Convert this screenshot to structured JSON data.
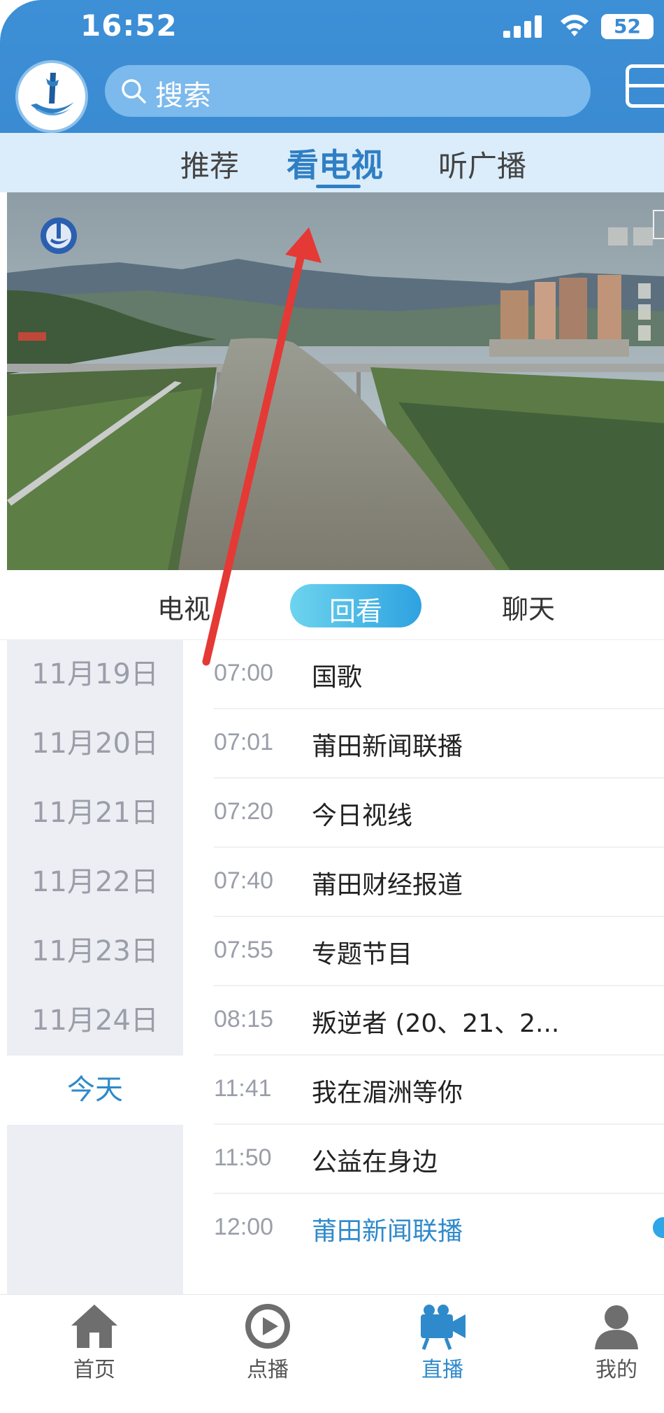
{
  "status_bar": {
    "time": "16:52",
    "battery": "52"
  },
  "header": {
    "search_placeholder": "搜索"
  },
  "channel_tabs": [
    {
      "label": "推荐",
      "active": false
    },
    {
      "label": "看电视",
      "active": true
    },
    {
      "label": "听广播",
      "active": false
    }
  ],
  "player_tabs": [
    {
      "label": "电视",
      "active": false
    },
    {
      "label": "回看",
      "active": true
    },
    {
      "label": "聊天",
      "active": false
    }
  ],
  "dates": [
    {
      "label": "11月19日",
      "active": false
    },
    {
      "label": "11月20日",
      "active": false
    },
    {
      "label": "11月21日",
      "active": false
    },
    {
      "label": "11月22日",
      "active": false
    },
    {
      "label": "11月23日",
      "active": false
    },
    {
      "label": "11月24日",
      "active": false
    },
    {
      "label": "今天",
      "active": true
    }
  ],
  "programs": [
    {
      "time": "07:00",
      "title": "国歌",
      "current": false
    },
    {
      "time": "07:01",
      "title": "莆田新闻联播",
      "current": false
    },
    {
      "time": "07:20",
      "title": "今日视线",
      "current": false
    },
    {
      "time": "07:40",
      "title": "莆田财经报道",
      "current": false
    },
    {
      "time": "07:55",
      "title": "专题节目",
      "current": false
    },
    {
      "time": "08:15",
      "title": "叛逆者 (20、21、2...",
      "current": false
    },
    {
      "time": "11:41",
      "title": "我在湄洲等你",
      "current": false
    },
    {
      "time": "11:50",
      "title": "公益在身边",
      "current": false
    },
    {
      "time": "12:00",
      "title": "莆田新闻联播",
      "current": true
    }
  ],
  "bottom_nav": [
    {
      "label": "首页",
      "icon": "home-icon",
      "active": false
    },
    {
      "label": "点播",
      "icon": "play-icon",
      "active": false
    },
    {
      "label": "直播",
      "icon": "camera-icon",
      "active": true
    },
    {
      "label": "我的",
      "icon": "user-icon",
      "active": false
    }
  ],
  "colors": {
    "header_blue": "#3a8bd2",
    "accent": "#2f8acb",
    "annotation_arrow": "#e53935"
  }
}
